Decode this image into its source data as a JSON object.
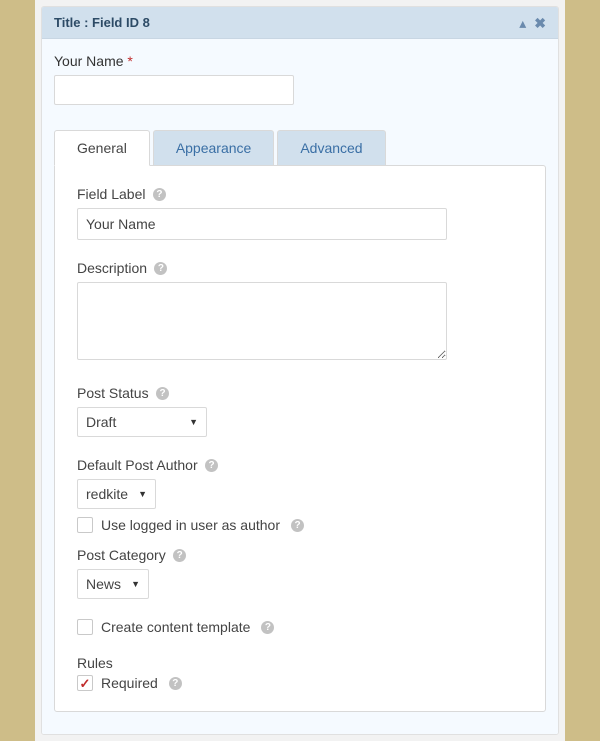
{
  "panel": {
    "title": "Title : Field ID 8"
  },
  "preview": {
    "label": "Your Name",
    "required": true,
    "value": ""
  },
  "tabs": {
    "general": "General",
    "appearance": "Appearance",
    "advanced": "Advanced"
  },
  "form": {
    "field_label": {
      "label": "Field Label",
      "value": "Your Name"
    },
    "description": {
      "label": "Description",
      "value": ""
    },
    "post_status": {
      "label": "Post Status",
      "value": "Draft"
    },
    "default_post_author": {
      "label": "Default Post Author",
      "value": "redkite"
    },
    "use_logged_in": {
      "label": "Use logged in user as author",
      "checked": false
    },
    "post_category": {
      "label": "Post Category",
      "value": "News"
    },
    "create_content_template": {
      "label": "Create content template",
      "checked": false
    },
    "rules": {
      "heading": "Rules",
      "required_label": "Required",
      "required_checked": true
    }
  }
}
